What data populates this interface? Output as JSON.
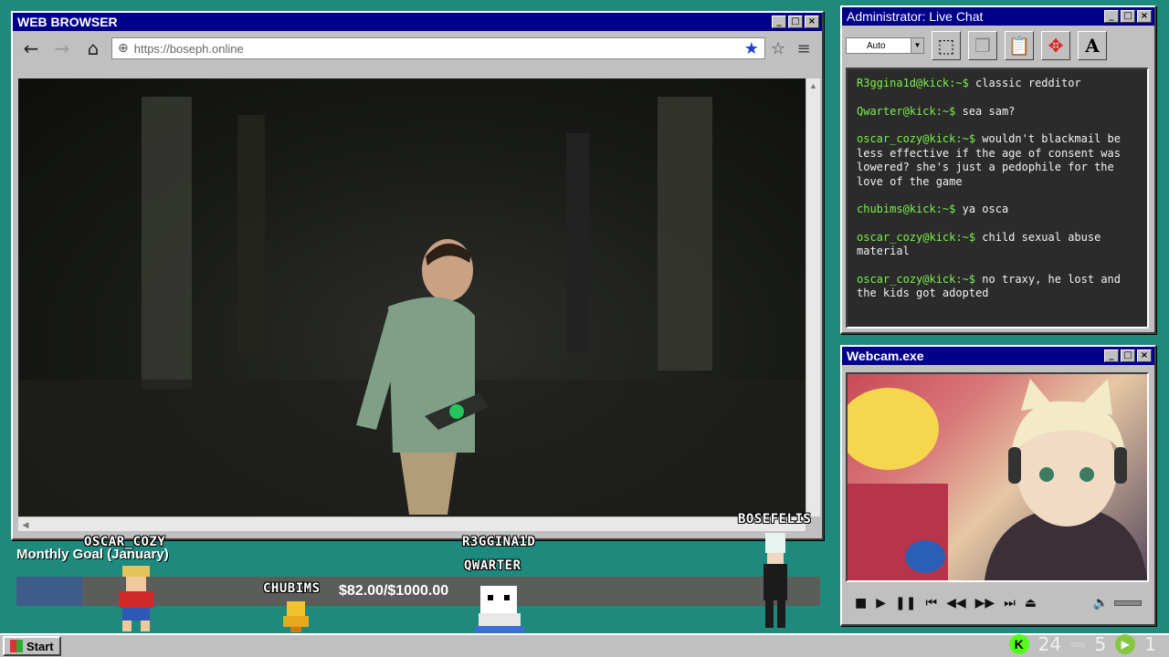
{
  "browser": {
    "title": "WEB BROWSER",
    "url": "https://boseph.online",
    "icons": {
      "back": "arrow-left",
      "forward": "arrow-right",
      "home": "home",
      "globe": "globe",
      "bookmark": "star-filled",
      "favorite": "star-outline",
      "menu": "hamburger"
    }
  },
  "chat": {
    "title": "Administrator: Live Chat",
    "select_value": "Auto",
    "messages": [
      {
        "user": "R3ggina1d@kick:~$",
        "text": " classic redditor"
      },
      {
        "user": "Qwarter@kick:~$",
        "text": " sea sam?"
      },
      {
        "user": "oscar_cozy@kick:~$",
        "text": " wouldn't blackmail be less effective if the age of consent was lowered? she's just a pedophile for the love of the game"
      },
      {
        "user": "chubims@kick:~$",
        "text": " ya osca"
      },
      {
        "user": "oscar_cozy@kick:~$",
        "text": " child sexual abuse material"
      },
      {
        "user": "oscar_cozy@kick:~$",
        "text": " no traxy, he lost and the kids got adopted"
      }
    ]
  },
  "webcam": {
    "title": "Webcam.exe"
  },
  "overlay": {
    "goal_title": "Monthly Goal (January)",
    "goal_text": "$82.00/$1000.00",
    "goal_progress": 0.082,
    "viewers": [
      "OSCAR_COZY",
      "CHUBIMS",
      "R3GGINA1D",
      "QWARTER",
      "BOSEFELIS"
    ]
  },
  "taskbar": {
    "start_label": "Start",
    "kick_count": "24",
    "cozy_label": "cozy",
    "rumble_count_a": "5",
    "rumble_count_b": "1"
  },
  "colors": {
    "titlebar": "#000088",
    "desktop": "#1e8a7e",
    "chat_user": "#7af04a"
  }
}
